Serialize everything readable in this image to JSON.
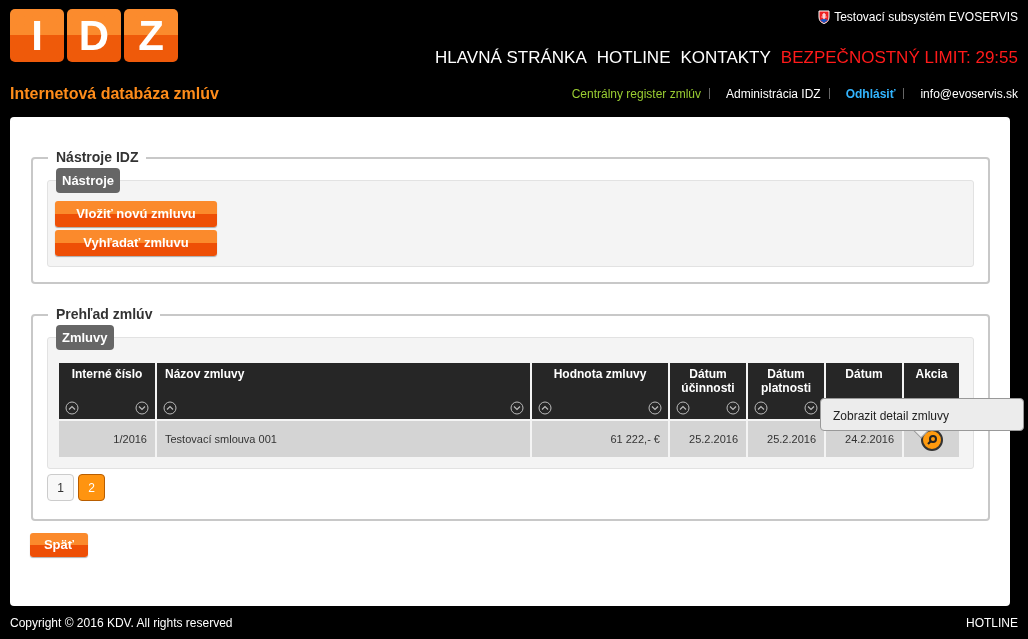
{
  "logo": {
    "letters": [
      "I",
      "D",
      "Z"
    ],
    "subtitle": "Internetová databáza zmlúv"
  },
  "system": {
    "label": "Testovací subsystém EVOSERVIS"
  },
  "main_nav": [
    {
      "label": "HLAVNÁ STRÁNKA",
      "kind": "link"
    },
    {
      "label": "HOTLINE",
      "kind": "link"
    },
    {
      "label": "KONTAKTY",
      "kind": "link"
    },
    {
      "label": "BEZPEČNOSTNÝ LIMIT: 29:55",
      "kind": "alert"
    }
  ],
  "sub_nav": [
    {
      "label": "Centrálny register zmlúv",
      "kind": "green"
    },
    {
      "label": "Administrácia IDZ",
      "kind": "plain"
    },
    {
      "label": "Odhlásiť",
      "kind": "blue"
    },
    {
      "label": "info@evoservis.sk",
      "kind": "plain"
    }
  ],
  "tools": {
    "legend": "Nástroje IDZ",
    "tab": "Nástroje",
    "buttons": [
      "Vložiť novú zmluvu",
      "Vyhľadať zmluvu"
    ]
  },
  "overview": {
    "legend": "Prehľad zmlúv",
    "tab": "Zmluvy",
    "columns": [
      {
        "label": "Interné číslo",
        "sortable": true
      },
      {
        "label": "Názov zmluvy",
        "sortable": true
      },
      {
        "label": "Hodnota zmluvy",
        "sortable": true
      },
      {
        "label": "Dátum účinnosti",
        "sortable": true
      },
      {
        "label": "Dátum platnosti",
        "sortable": true
      },
      {
        "label": "Dátum"
      },
      {
        "label": "Akcia"
      }
    ],
    "rows": [
      {
        "cells": [
          "1/2016",
          "Testovací smlouva 001",
          "61 222,- €",
          "25.2.2016",
          "25.2.2016",
          "24.2.2016"
        ]
      }
    ],
    "tooltip": "Zobrazit detail zmluvy",
    "pages": [
      {
        "label": "1",
        "selected": false
      },
      {
        "label": "2",
        "selected": true
      }
    ]
  },
  "back_button": "Späť",
  "footer": {
    "copyright": "Copyright © 2016 KDV. All rights reserved",
    "link": "HOTLINE"
  }
}
